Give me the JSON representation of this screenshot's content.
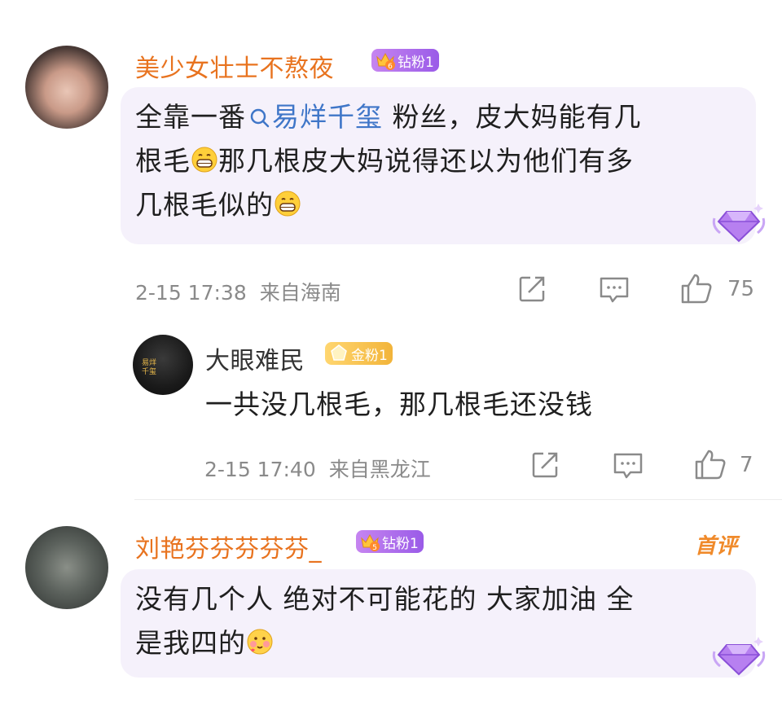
{
  "comments": [
    {
      "username": "美少女壮士不熬夜",
      "badge": {
        "level": "6",
        "label": "钻粉1"
      },
      "text_pre": "全靠一番",
      "mention": "易烊千玺",
      "text_line1_post": " 粉丝，皮大妈能有几",
      "text_line2_pre": "根毛",
      "text_line2_post": "那几根皮大妈说得还以为他们有多",
      "text_line3_pre": "几根毛似的",
      "time": "2-15 17:38",
      "location": "来自海南",
      "likes": "75"
    },
    {
      "username": "刘艳芬芬芬芬芬_",
      "badge": {
        "level": "5",
        "label": "钻粉1"
      },
      "first_comment_label": "首评",
      "text_line1": "没有几个人 绝对不可能花的 大家加油 全",
      "text_line2_pre": "是我四的"
    }
  ],
  "reply": {
    "username": "大眼难民",
    "badge": {
      "label": "金粉1"
    },
    "avatar_text": [
      "易烊",
      "千玺"
    ],
    "text": "一共没几根毛，那几根毛还没钱",
    "time": "2-15 17:40",
    "location": "来自黑龙江",
    "likes": "7"
  },
  "colors": {
    "username": "#e8731f",
    "mention": "#3f76c8",
    "bubble_bg": "#f5f1fb",
    "meta_text": "#8a8a8a"
  },
  "icons": [
    "share-icon",
    "comment-icon",
    "like-icon",
    "diamond-gem-icon",
    "search-icon",
    "grin-emoji-icon",
    "blush-emoji-icon"
  ]
}
